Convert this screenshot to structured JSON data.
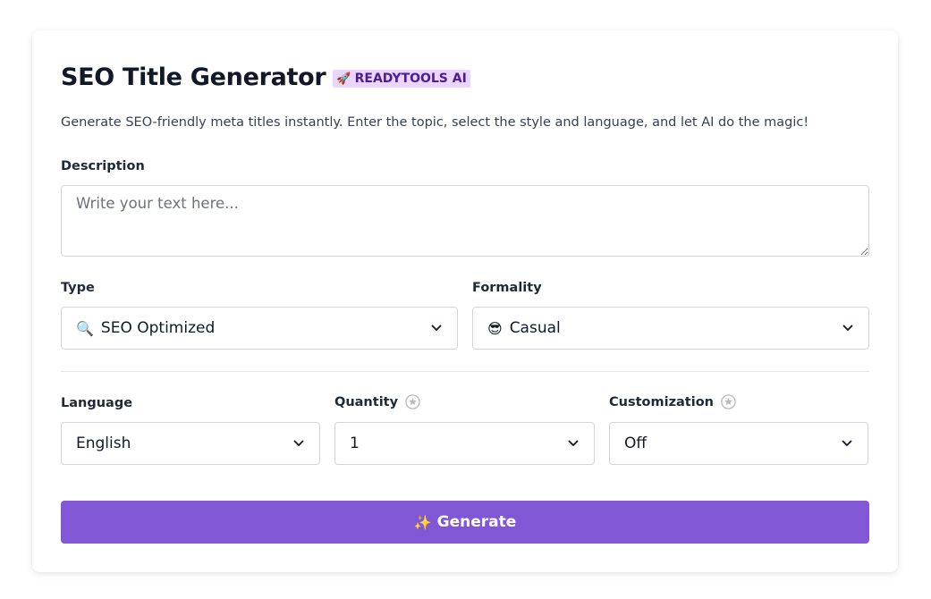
{
  "header": {
    "title": "SEO Title Generator",
    "badge_emoji": "🚀",
    "badge_label": "READYTOOLS AI",
    "subtitle": "Generate SEO-friendly meta titles instantly. Enter the topic, select the style and language, and let AI do the magic!"
  },
  "description": {
    "label": "Description",
    "placeholder": "Write your text here...",
    "value": ""
  },
  "type": {
    "label": "Type",
    "icon": "🔍",
    "selected": "SEO Optimized"
  },
  "formality": {
    "label": "Formality",
    "icon": "😎",
    "selected": "Casual"
  },
  "language": {
    "label": "Language",
    "selected": "English"
  },
  "quantity": {
    "label": "Quantity",
    "selected": "1"
  },
  "customization": {
    "label": "Customization",
    "selected": "Off"
  },
  "generate": {
    "icon": "✨",
    "label": "Generate"
  },
  "colors": {
    "accent": "#8257d6",
    "badge_bg": "#e9d5ff",
    "badge_text": "#4c1d95",
    "border": "#d1d5db"
  },
  "icons": {
    "select_chevron": "chevron-down-icon",
    "premium_info": "star-circle-icon"
  }
}
